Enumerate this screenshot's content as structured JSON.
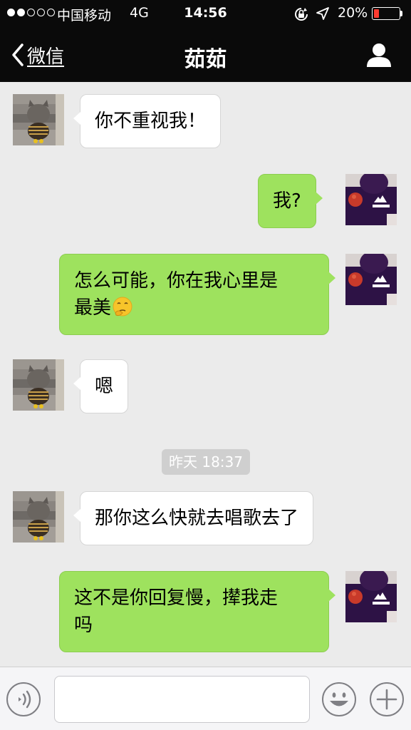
{
  "status_bar": {
    "signal_dots_filled": 2,
    "signal_dots_total": 5,
    "carrier": "中国移动",
    "network": "4G",
    "time": "14:56",
    "battery_percent": "20%",
    "battery_level": 0.2,
    "battery_color": "#ff3b30"
  },
  "nav": {
    "back_label": "微信",
    "title": "茹茹",
    "profile_icon": "person-icon"
  },
  "messages": [
    {
      "side": "in",
      "text": "你不重视我！"
    },
    {
      "side": "out",
      "text": "我?"
    },
    {
      "side": "out",
      "text_lines": [
        "怎么可能，你在我心里是",
        "最美"
      ],
      "emoji": "thinking-face-emoji"
    },
    {
      "side": "in",
      "text": "嗯"
    },
    {
      "side": "in",
      "text": "那你这么快就去唱歌去了"
    },
    {
      "side": "out",
      "text_lines": [
        "这不是你回复慢，撵我走",
        "吗"
      ]
    }
  ],
  "timestamp": "昨天 18:37",
  "input_bar": {
    "voice_icon": "voice-icon",
    "input_value": "",
    "emoji_icon": "emoji-icon",
    "plus_icon": "plus-icon"
  },
  "colors": {
    "bar_bg": "#0a0a0a",
    "chat_bg": "#ebebeb",
    "outgoing_bubble": "#9ee25e",
    "incoming_bubble": "#ffffff",
    "timestamp_bg": "#cfcfcf"
  }
}
